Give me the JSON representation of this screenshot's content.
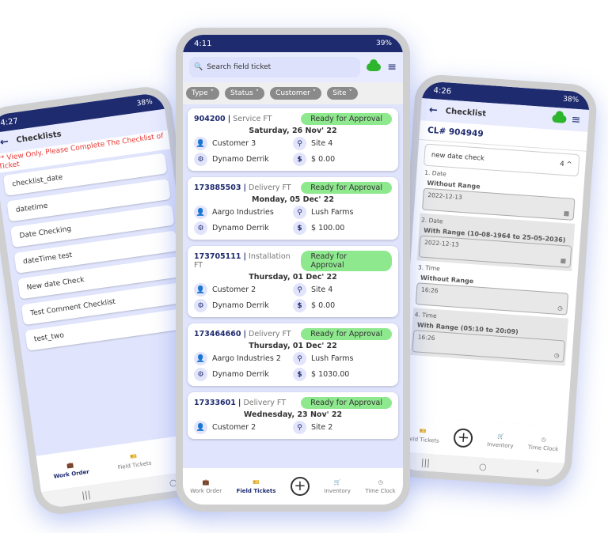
{
  "left": {
    "status": {
      "time": "4:27",
      "right": "38%"
    },
    "title": "Checklists",
    "warning": "** View Only. Please Complete The Checklist of Ticket",
    "items": [
      "checklist_date",
      "datetime",
      "Date Checking",
      "dateTime test",
      "New date Check",
      "Test Comment Checklist",
      "test_two"
    ],
    "nav": {
      "work_order": "Work Order",
      "field_tickets": "Field Tickets"
    }
  },
  "center": {
    "status": {
      "time": "4:11",
      "right": "39%"
    },
    "search_placeholder": "Search field ticket",
    "filters": [
      "Type",
      "Status",
      "Customer",
      "Site"
    ],
    "cards": [
      {
        "num": "904200",
        "type": "Service FT",
        "status": "Ready for Approval",
        "date": "Saturday, 26 Nov' 22",
        "customer": "Customer 3",
        "site": "Site 4",
        "tech": "Dynamo Derrik",
        "amount": "$ 0.00"
      },
      {
        "num": "173885503",
        "type": "Delivery FT",
        "status": "Ready for Approval",
        "date": "Monday, 05 Dec' 22",
        "customer": "Aargo Industries",
        "site": "Lush Farms",
        "tech": "Dynamo Derrik",
        "amount": "$ 100.00"
      },
      {
        "num": "173705111",
        "type": "Installation FT",
        "status": "Ready for Approval",
        "date": "Thursday, 01 Dec' 22",
        "customer": "Customer 2",
        "site": "Site 4",
        "tech": "Dynamo Derrik",
        "amount": "$ 0.00"
      },
      {
        "num": "173464660",
        "type": "Delivery FT",
        "status": "Ready for Approval",
        "date": "Thursday, 01 Dec' 22",
        "customer": "Aargo Industries 2",
        "site": "Lush Farms",
        "tech": "Dynamo Derrik",
        "amount": "$ 1030.00"
      },
      {
        "num": "17333601",
        "type": "Delivery FT",
        "status": "Ready for Approval",
        "date": "Wednesday, 23 Nov' 22",
        "customer": "Customer 2",
        "site": "Site 2",
        "tech": "",
        "amount": ""
      }
    ],
    "nav": {
      "work_order": "Work Order",
      "field_tickets": "Field Tickets",
      "inventory": "Inventory",
      "time_clock": "Time Clock"
    }
  },
  "right": {
    "status": {
      "time": "4:26",
      "right": "38%"
    },
    "title": "Checklist",
    "cl_id": "CL# 904949",
    "accordion": {
      "name": "new date check",
      "count": "4"
    },
    "sections": [
      {
        "head": "1. Date",
        "label": "Without Range",
        "value": "2022-12-13"
      },
      {
        "head": "2. Date",
        "label": "With Range (10-08-1964 to 25-05-2036)",
        "value": "2022-12-13"
      },
      {
        "head": "3. Time",
        "label": "Without Range",
        "value": "16:26"
      },
      {
        "head": "4. Time",
        "label": "With Range (05:10 to 20:09)",
        "value": "16:26"
      }
    ],
    "nav": {
      "field_tickets": "Field Tickets",
      "inventory": "Inventory",
      "time_clock": "Time Clock"
    }
  }
}
